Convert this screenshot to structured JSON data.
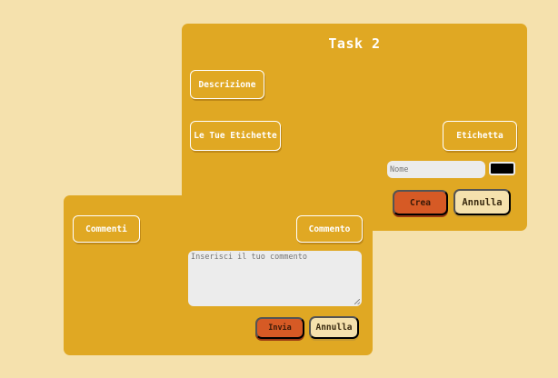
{
  "colors": {
    "page_background": "#f5e1ad",
    "panel": "#e0a823",
    "primary_button": "#d65a25",
    "secondary_button": "#f5e1ad",
    "field": "#ececec",
    "label_color_value": "#000000"
  },
  "task": {
    "title": "Task 2",
    "description_button": "Descrizione",
    "labels_button": "Le Tue Etichette",
    "add_label_button": "Etichetta",
    "name_placeholder": "Nome",
    "create_button": "Crea",
    "cancel_button": "Annulla"
  },
  "comments": {
    "comments_button": "Commenti",
    "add_comment_button": "Commento",
    "comment_placeholder": "Inserisci il tuo commento",
    "send_button": "Invia",
    "cancel_button": "Annulla"
  }
}
